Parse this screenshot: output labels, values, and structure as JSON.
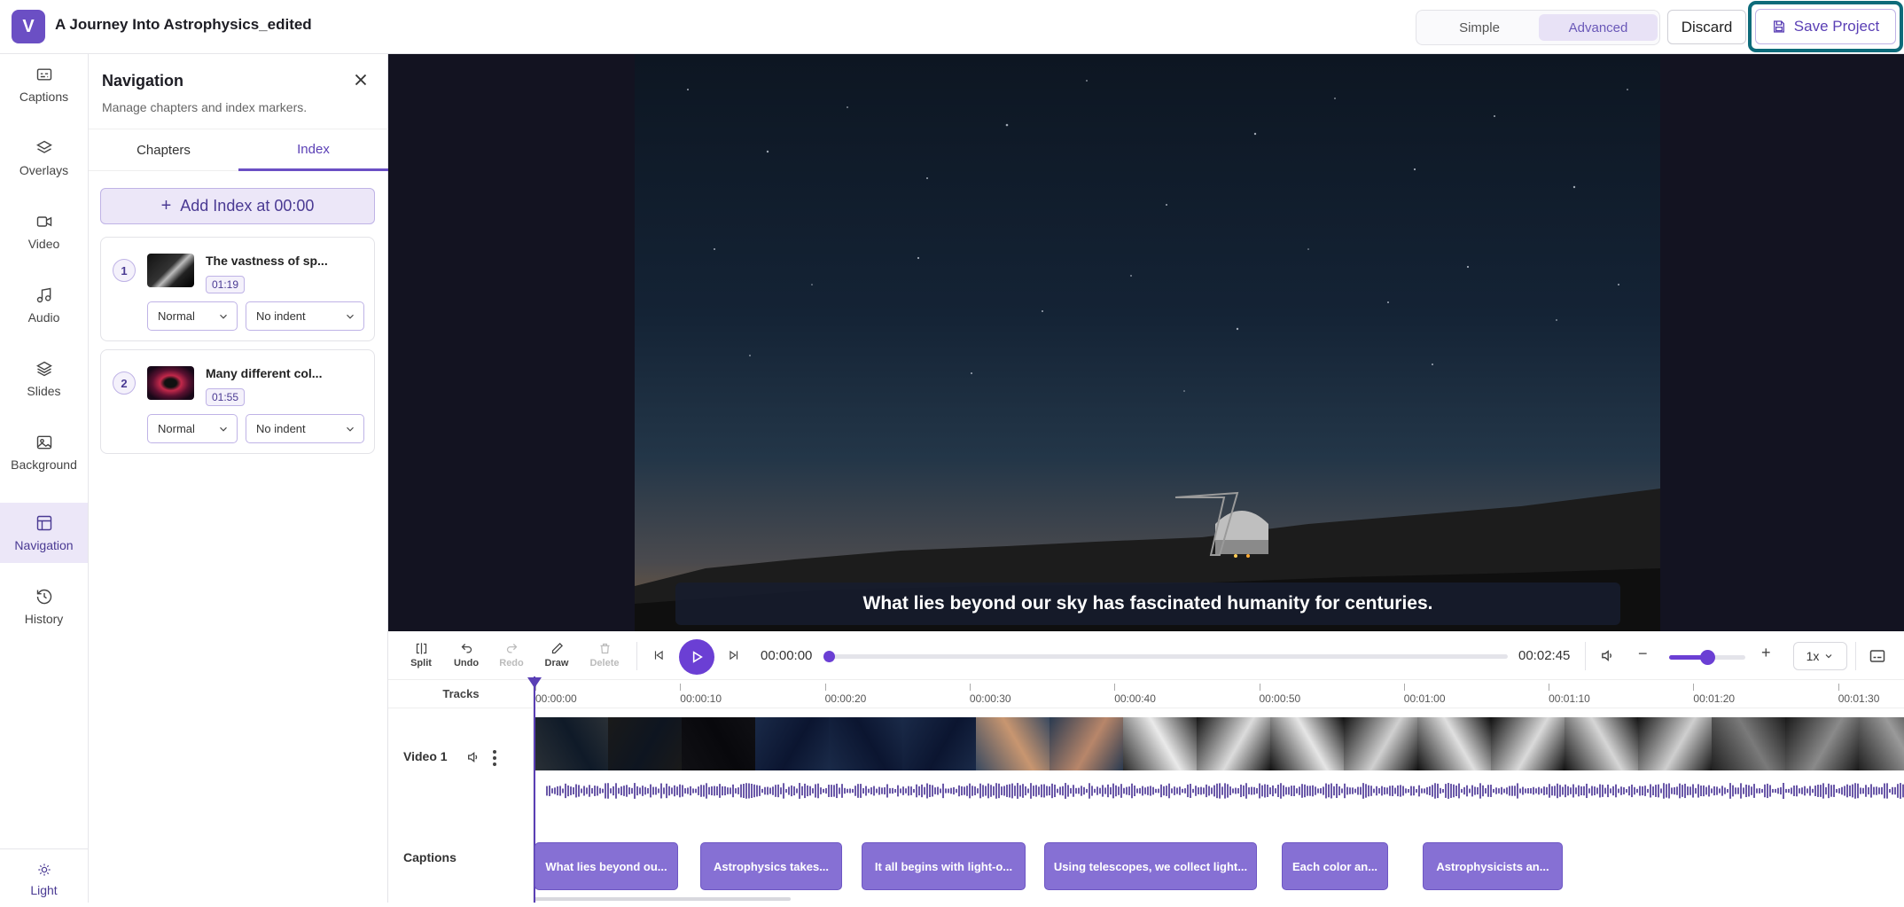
{
  "header": {
    "logo_letter": "V",
    "title": "A Journey Into Astrophysics_edited",
    "mode_simple": "Simple",
    "mode_advanced": "Advanced",
    "discard_label": "Discard",
    "save_label": "Save Project"
  },
  "rail": {
    "items": [
      "Captions",
      "Overlays",
      "Video",
      "Audio",
      "Slides",
      "Background",
      "Navigation",
      "History"
    ],
    "active": "Navigation",
    "theme_label": "Light"
  },
  "nav_panel": {
    "title": "Navigation",
    "subtitle": "Manage chapters and index markers.",
    "tabs": [
      "Chapters",
      "Index"
    ],
    "active_tab": "Index",
    "add_label": "Add Index at 00:00",
    "entries": [
      {
        "num": "1",
        "title": "The vastness of sp...",
        "time": "01:19",
        "style": "Normal",
        "indent": "No indent"
      },
      {
        "num": "2",
        "title": "Many different col...",
        "time": "01:55",
        "style": "Normal",
        "indent": "No indent"
      }
    ]
  },
  "player": {
    "caption": "What lies beyond our sky has fascinated humanity for centuries.",
    "time_current": "00:00:00",
    "time_total": "00:02:45",
    "progress": 0.0,
    "speed": "1x",
    "zoom_level": 0.5
  },
  "tools": {
    "split": "Split",
    "undo": "Undo",
    "redo": "Redo",
    "draw": "Draw",
    "delete": "Delete"
  },
  "timeline": {
    "tracks_header": "Tracks",
    "video_track": "Video 1",
    "captions_track": "Captions",
    "ticks": [
      "00:00:00",
      "00:00:10",
      "00:00:20",
      "00:00:30",
      "00:00:40",
      "00:00:50",
      "00:01:00",
      "00:01:10",
      "00:01:20",
      "00:01:30"
    ],
    "captions": [
      "What lies beyond ou...",
      "Astrophysics takes...",
      "It all begins with light-o...",
      "Using telescopes, we collect light...",
      "Each color an...",
      "Astrophysicists an..."
    ]
  },
  "colors": {
    "accent": "#6b3fd4",
    "active_bg": "#ece7f8",
    "save_outline": "#0d6b7a"
  }
}
